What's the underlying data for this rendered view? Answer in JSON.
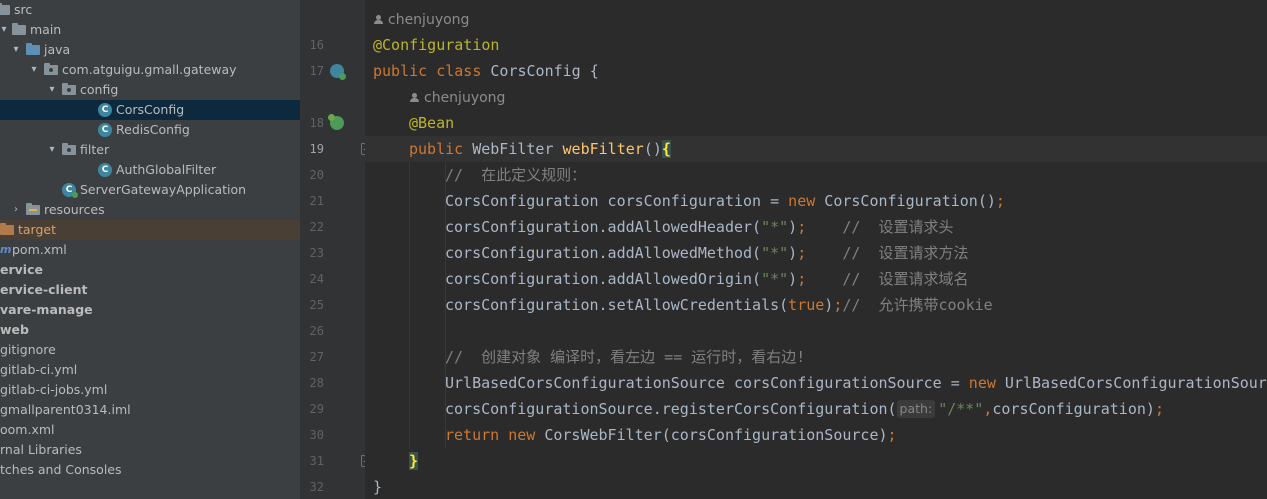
{
  "project_tree": {
    "rows": [
      {
        "label": "src",
        "arrow": "",
        "icon": "folder",
        "depth": 0
      },
      {
        "label": "main",
        "arrow": "▾",
        "icon": "folder",
        "depth": 0
      },
      {
        "label": "java",
        "arrow": "▾",
        "icon": "folder-blue",
        "depth": 1
      },
      {
        "label": "com.atguigu.gmall.gateway",
        "arrow": "▾",
        "icon": "package",
        "depth": 2
      },
      {
        "label": "config",
        "arrow": "▾",
        "icon": "package",
        "depth": 3
      },
      {
        "label": "CorsConfig",
        "arrow": "",
        "icon": "class",
        "depth": 4,
        "selected": true
      },
      {
        "label": "RedisConfig",
        "arrow": "",
        "icon": "class",
        "depth": 4
      },
      {
        "label": "filter",
        "arrow": "▾",
        "icon": "package",
        "depth": 3
      },
      {
        "label": "AuthGlobalFilter",
        "arrow": "",
        "icon": "class",
        "depth": 4
      },
      {
        "label": "ServerGatewayApplication",
        "arrow": "",
        "icon": "app-class",
        "depth": 3
      },
      {
        "label": "resources",
        "arrow": "›",
        "icon": "resources",
        "depth": 1
      },
      {
        "label": "target",
        "arrow": "",
        "icon": "folder-orange",
        "depth": 0
      },
      {
        "label": "pom.xml",
        "arrow": "",
        "icon": "maven",
        "depth": 0
      },
      {
        "label": "ervice",
        "arrow": "",
        "icon": "",
        "depth": 0,
        "bold": true
      },
      {
        "label": "ervice-client",
        "arrow": "",
        "icon": "",
        "depth": 0,
        "bold": true
      },
      {
        "label": "vare-manage",
        "arrow": "",
        "icon": "",
        "depth": 0,
        "bold": true
      },
      {
        "label": "web",
        "arrow": "",
        "icon": "",
        "depth": 0,
        "bold": true
      },
      {
        "label": "gitignore",
        "arrow": "",
        "icon": "",
        "depth": 0
      },
      {
        "label": "gitlab-ci.yml",
        "arrow": "",
        "icon": "",
        "depth": 0
      },
      {
        "label": "gitlab-ci-jobs.yml",
        "arrow": "",
        "icon": "",
        "depth": 0
      },
      {
        "label": "gmallparent0314.iml",
        "arrow": "",
        "icon": "",
        "depth": 0
      },
      {
        "label": "oom.xml",
        "arrow": "",
        "icon": "",
        "depth": 0
      },
      {
        "label": "rnal Libraries",
        "arrow": "",
        "icon": "",
        "depth": 0
      },
      {
        "label": "tches and Consoles",
        "arrow": "",
        "icon": "",
        "depth": 0
      }
    ]
  },
  "editor": {
    "author_1": "chenjuyong",
    "author_2": "chenjuyong",
    "line_numbers": [
      "16",
      "17",
      "18",
      "19",
      "20",
      "21",
      "22",
      "23",
      "24",
      "25",
      "26",
      "27",
      "28",
      "29",
      "30",
      "31",
      "32"
    ],
    "current_line": "19",
    "lines": {
      "l16": "@Configuration",
      "l17_kw": "public class ",
      "l17_rest": "CorsConfig {",
      "l18": "@Bean",
      "l19_kw": "public ",
      "l19_type": "WebFilter ",
      "l19_fn": "webFilter",
      "l19_paren": "()",
      "l19_brace": "{",
      "l20": "//  在此定义规则：",
      "l21_a": "CorsConfiguration corsConfiguration = ",
      "l21_kw": "new ",
      "l21_b": "CorsConfiguration()",
      "l21_semi": ";",
      "l22_a": "corsConfiguration.addAllowedHeader(",
      "l22_str": "\"*\"",
      "l22_b": ")",
      "l22_semi": ";",
      "l22_cmt": "    //  设置请求头",
      "l23_a": "corsConfiguration.addAllowedMethod(",
      "l23_str": "\"*\"",
      "l23_b": ")",
      "l23_semi": ";",
      "l23_cmt": "    //  设置请求方法",
      "l24_a": "corsConfiguration.addAllowedOrigin(",
      "l24_str": "\"*\"",
      "l24_b": ")",
      "l24_semi": ";",
      "l24_cmt": "    //  设置请求域名",
      "l25_a": "corsConfiguration.setAllowCredentials(",
      "l25_kw": "true",
      "l25_b": ")",
      "l25_semi": ";",
      "l25_cmt": "//  允许携带cookie",
      "l27": "//  创建对象 编译时，看左边 == 运行时，看右边!",
      "l28_a": "UrlBasedCorsConfigurationSource corsConfigurationSource = ",
      "l28_kw": "new ",
      "l28_b": "UrlBasedCorsConfigurationSource",
      "l29_a": "corsConfigurationSource.registerCorsConfiguration(",
      "l29_hint": "path:",
      "l29_str": "\"/**\"",
      "l29_comma": ",",
      "l29_b": "corsConfiguration)",
      "l29_semi": ";",
      "l30_kw": "return new ",
      "l30_b": "CorsWebFilter(corsConfigurationSource)",
      "l30_semi": ";",
      "l31": "}",
      "l32": "}"
    }
  },
  "colors": {
    "keyword": "#cc7832",
    "annotation": "#bbb529",
    "comment": "#808080",
    "string": "#6a8759",
    "method": "#ffc66d",
    "default": "#a9b7c6",
    "selected_row": "#0d293e"
  }
}
